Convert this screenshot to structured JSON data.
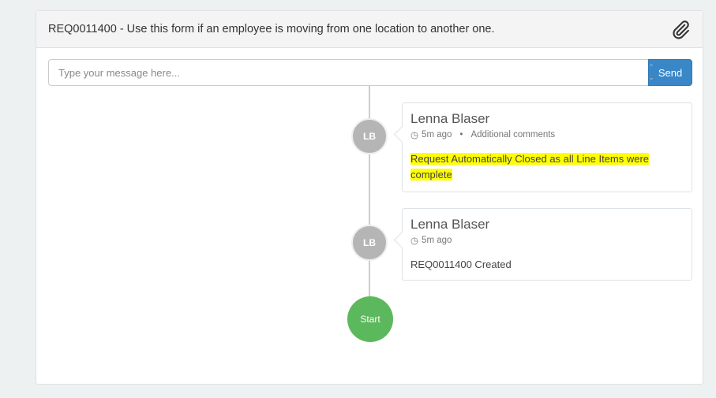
{
  "header": {
    "title": "REQ0011400 - Use this form if an employee is moving from one location to another one.",
    "attach_icon": "paperclip-icon"
  },
  "composer": {
    "placeholder": "Type your message here...",
    "value": "",
    "send_label": "Send"
  },
  "timeline": [
    {
      "initials": "LB",
      "author": "Lenna Blaser",
      "time": "5m ago",
      "type": "Additional comments",
      "text": "Request Automatically Closed as all Line Items were complete",
      "highlight_color": "#ffff00"
    },
    {
      "initials": "LB",
      "author": "Lenna Blaser",
      "time": "5m ago",
      "text": "REQ0011400 Created"
    }
  ],
  "start_label": "Start",
  "colors": {
    "accent": "#3a87c8",
    "start": "#5cb85c",
    "avatar": "#b5b5b5"
  }
}
